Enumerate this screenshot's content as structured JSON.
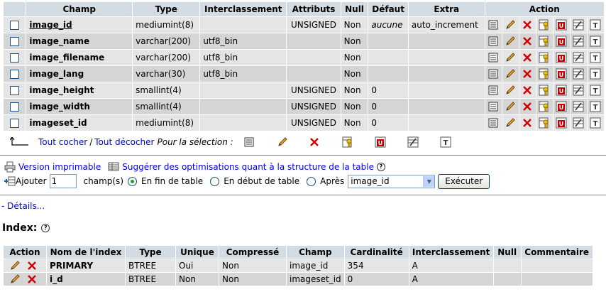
{
  "structure": {
    "headers": [
      "Champ",
      "Type",
      "Interclassement",
      "Attributs",
      "Null",
      "Défaut",
      "Extra",
      "Action"
    ],
    "rows": [
      {
        "field": "image_id",
        "type": "mediumint(8)",
        "collation": "",
        "attributes": "UNSIGNED",
        "null": "Non",
        "default": "aucune",
        "extra": "auto_increment"
      },
      {
        "field": "image_name",
        "type": "varchar(200)",
        "collation": "utf8_bin",
        "attributes": "",
        "null": "Non",
        "default": "",
        "extra": ""
      },
      {
        "field": "image_filename",
        "type": "varchar(200)",
        "collation": "utf8_bin",
        "attributes": "",
        "null": "Non",
        "default": "",
        "extra": ""
      },
      {
        "field": "image_lang",
        "type": "varchar(30)",
        "collation": "utf8_bin",
        "attributes": "",
        "null": "Non",
        "default": "",
        "extra": ""
      },
      {
        "field": "image_height",
        "type": "smallint(4)",
        "collation": "",
        "attributes": "UNSIGNED",
        "null": "Non",
        "default": "0",
        "extra": ""
      },
      {
        "field": "image_width",
        "type": "smallint(4)",
        "collation": "",
        "attributes": "UNSIGNED",
        "null": "Non",
        "default": "0",
        "extra": ""
      },
      {
        "field": "imageset_id",
        "type": "mediumint(8)",
        "collation": "",
        "attributes": "UNSIGNED",
        "null": "Non",
        "default": "0",
        "extra": ""
      }
    ],
    "action_icons": [
      "browse-icon",
      "edit-icon",
      "drop-icon",
      "primary-key-icon",
      "unique-icon",
      "index-icon",
      "fulltext-icon"
    ]
  },
  "bulk": {
    "check_all": "Tout cocher",
    "separator": "/",
    "uncheck_all": "Tout décocher",
    "with_selected": "Pour la sélection :"
  },
  "links": {
    "print": "Version imprimable",
    "propose": "Suggérer des optimisations quant à la structure de la table"
  },
  "add_fields": {
    "label": "Ajouter",
    "count": "1",
    "fields_label": "champ(s)",
    "at_end": "En fin de table",
    "at_beginning": "En début de table",
    "after": "Après",
    "after_field": "image_id",
    "submit": "Exécuter"
  },
  "details_link": "- Détails...",
  "index": {
    "title": "Index:",
    "headers": [
      "Action",
      "Nom de l'index",
      "Type",
      "Unique",
      "Compressé",
      "Champ",
      "Cardinalité",
      "Interclassement",
      "Null",
      "Commentaire"
    ],
    "rows": [
      {
        "name": "PRIMARY",
        "type": "BTREE",
        "unique": "Oui",
        "packed": "Non",
        "column": "image_id",
        "cardinality": "354",
        "collation": "A",
        "null": "",
        "comment": ""
      },
      {
        "name": "i_d",
        "type": "BTREE",
        "unique": "Non",
        "packed": "Non",
        "column": "imageset_id",
        "cardinality": "0",
        "collation": "A",
        "null": "",
        "comment": ""
      }
    ]
  },
  "colors": {
    "header_bg": "#d3dce3",
    "row_odd": "#e5e5e5",
    "row_even": "#d5d5d5",
    "link": "#0000ee"
  }
}
